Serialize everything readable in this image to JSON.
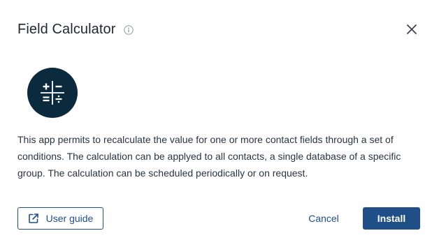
{
  "dialog": {
    "title": "Field Calculator",
    "info_icon": "info-icon",
    "close_icon": "close-icon"
  },
  "app": {
    "logo_icon": "calculator-operators-icon",
    "logo_color": "#0b2a3d",
    "description": "This app permits to recalculate the value for one or more contact fields through a set of conditions. The calculation can be applyed to all contacts, a single database of a specific group. The calculation can be scheduled periodically or on request."
  },
  "actions": {
    "user_guide_label": "User guide",
    "user_guide_icon": "external-link-icon",
    "cancel_label": "Cancel",
    "install_label": "Install"
  },
  "colors": {
    "primary": "#1f4f86",
    "text": "#1f2733"
  }
}
